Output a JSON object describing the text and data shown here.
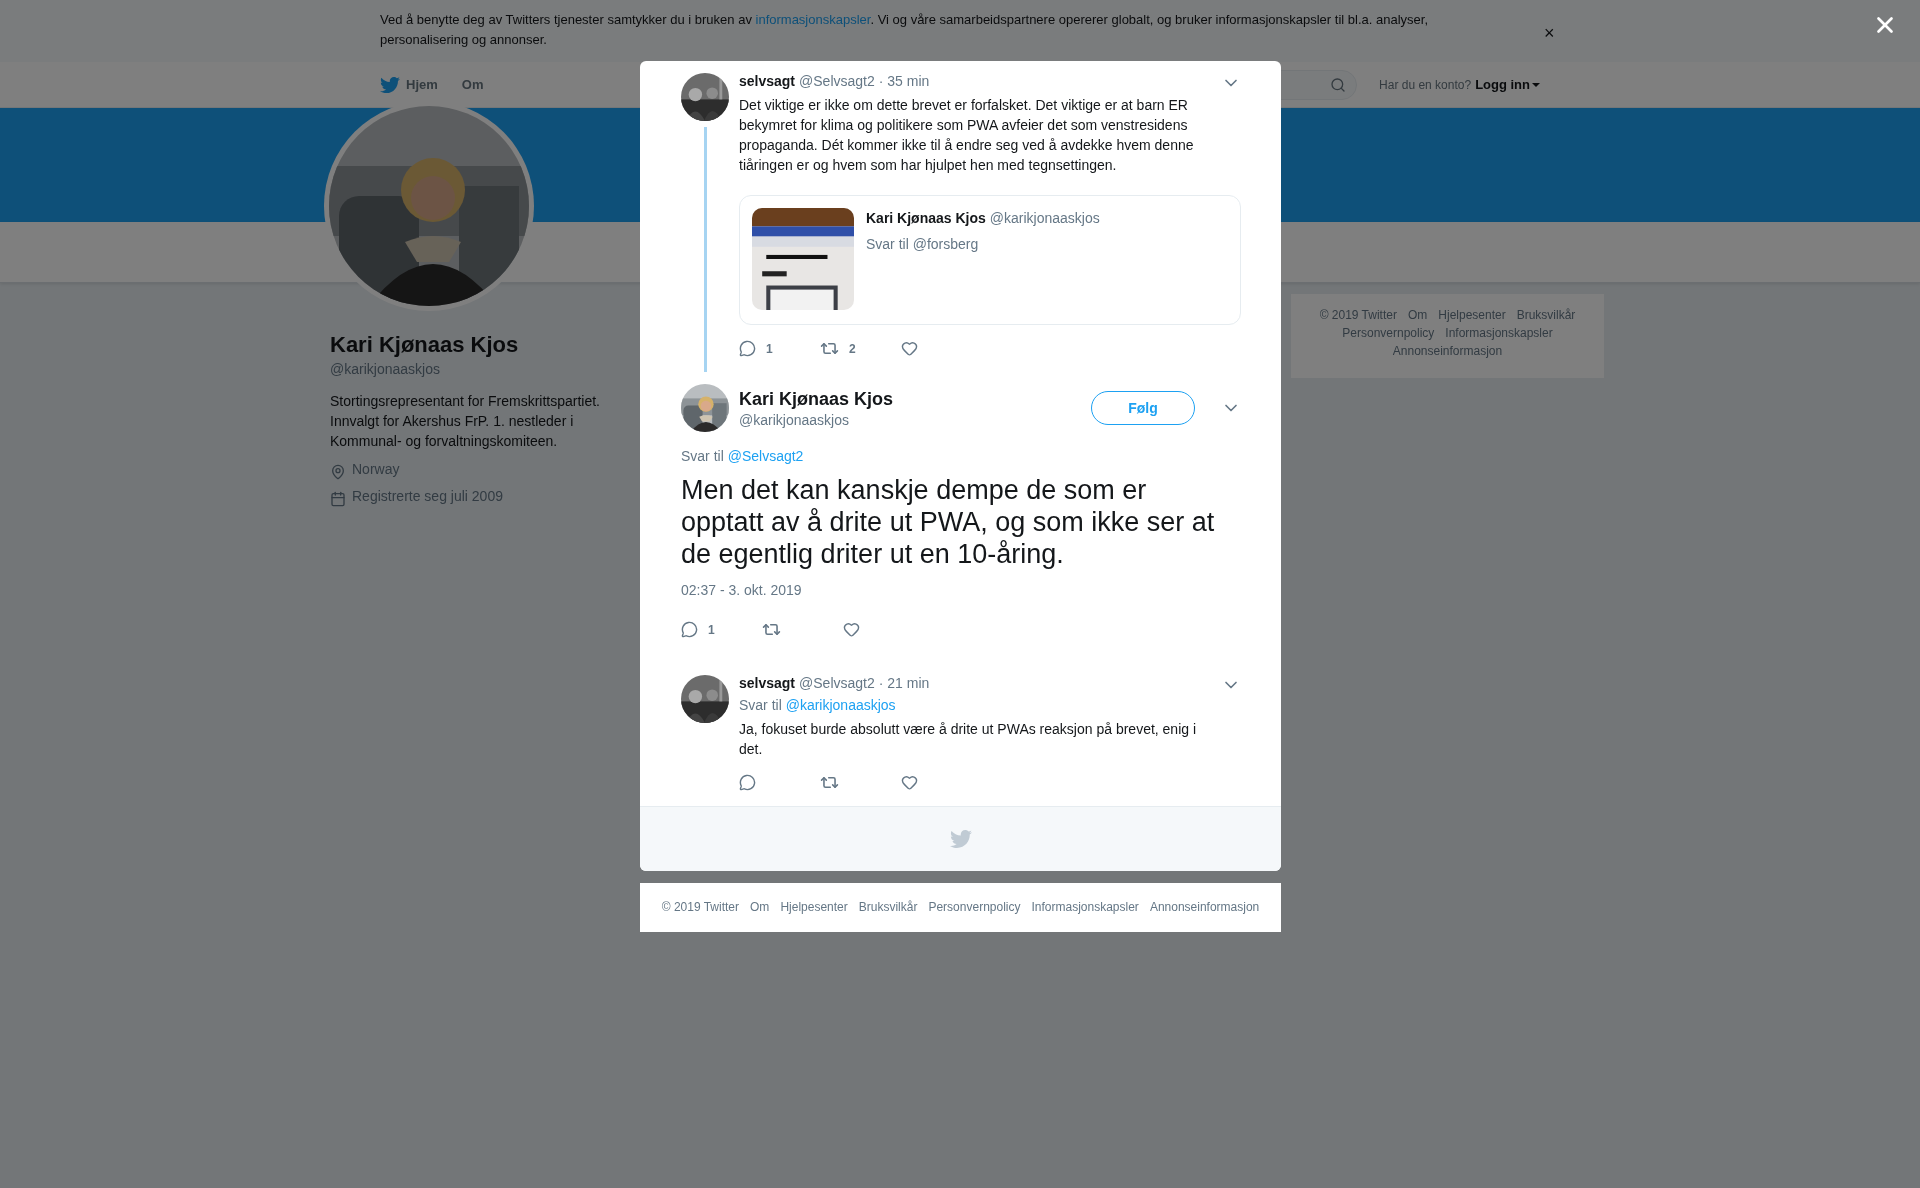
{
  "cookie_banner": {
    "text_before": "Ved å benytte deg av Twitters tjenester samtykker du i bruken av ",
    "link": "informasjonskapsler",
    "text_after": ". Vi og våre samarbeidspartnere opererer globalt, og bruker informasjonskapsler til bl.a. analyser, personalisering og annonser.",
    "close": "×"
  },
  "header": {
    "nav": [
      "Hjem",
      "Om"
    ],
    "login_prompt": "Har du en konto?",
    "login": "Logg inn"
  },
  "profile": {
    "name": "Kari Kjønaas Kjos",
    "handle": "@karikjonaaskjos",
    "bio": "Stortingsrepresentant for Fremskrittspartiet. Innvalgt for Akershus FrP. 1. nestleder i Kommunal- og forvaltningskomiteen.",
    "location": "Norway",
    "joined": "Registrerte seg juli 2009"
  },
  "sidebar_footer": [
    "© 2019 Twitter",
    "Om",
    "Hjelpesenter",
    "Bruksvilkår",
    "Personvernpolicy",
    "Informasjonskapsler",
    "Annonseinformasjon"
  ],
  "modal": {
    "tweets": [
      {
        "kind": "parent",
        "name": "selvsagt",
        "handle": "@Selvsagt2",
        "time": "· 35 min",
        "text": "Det viktige er ikke om dette brevet er forfalsket. Det viktige er at barn ER bekymret for klima og politikere som PWA avfeier det som venstresidens propaganda. Dét kommer ikke til å endre seg ved å avdekke hvem denne tiåringen er og hvem som har hjulpet hen med tegnsettingen.",
        "quote": {
          "name": "Kari Kjønaas Kjos",
          "handle": "@karikjonaaskjos",
          "reply_label": "Svar til",
          "reply_to": "@forsberg"
        },
        "replies": "1",
        "retweets": "2"
      },
      {
        "kind": "main",
        "name": "Kari Kjønaas Kjos",
        "handle": "@karikjonaaskjos",
        "follow": "Følg",
        "reply_label": "Svar til",
        "reply_to": "@Selvsagt2",
        "text": "Men det kan kanskje dempe de som er opptatt av å drite ut PWA, og som ikke ser at de egentlig driter ut en 10-åring.",
        "timestamp": "02:37 - 3. okt. 2019",
        "replies": "1"
      },
      {
        "kind": "reply",
        "name": "selvsagt",
        "handle": "@Selvsagt2",
        "time": "· 21 min",
        "reply_label": "Svar til",
        "reply_to": "@karikjonaaskjos",
        "text": "Ja, fokuset burde absolutt være å drite ut PWAs reaksjon på brevet, enig i det."
      }
    ]
  },
  "page_footer": [
    "© 2019 Twitter",
    "Om",
    "Hjelpesenter",
    "Bruksvilkår",
    "Personvernpolicy",
    "Informasjonskapsler",
    "Annonseinformasjon"
  ]
}
